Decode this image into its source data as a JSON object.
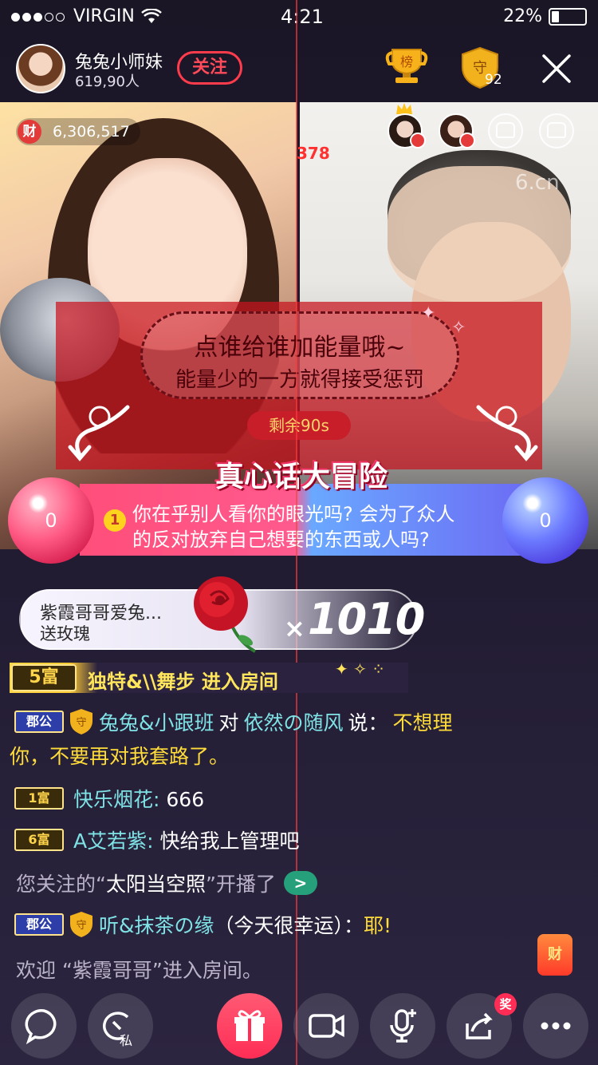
{
  "status_bar": {
    "carrier": "VIRGIN",
    "time": "4:21",
    "battery": "22%"
  },
  "header": {
    "host_name": "兔兔小师妹",
    "host_count": "619,90人",
    "follow_label": "关注",
    "rank_label": "榜",
    "guard_label": "守",
    "guard_count": "92"
  },
  "video": {
    "wealth_icon": "财",
    "wealth_value": "6,306,517",
    "coord_readout": "378",
    "watermark": "6.cn"
  },
  "task": {
    "line1": "点谁给谁加能量哦~",
    "line2": "能量少的一方就得接受惩罚",
    "countdown": "剩余90s",
    "title": "真心话大冒险",
    "question_number": "1",
    "question_line1": "你在乎别人看你的眼光吗? 会为了众人",
    "question_line2": "的反对放弃自己想要的东西或人吗?",
    "left_score": "0",
    "right_score": "0"
  },
  "gift": {
    "sender": "紫霞哥哥爱兔...",
    "action": "送玫瑰",
    "times": "×",
    "count": "1010"
  },
  "entrance": {
    "level": "5富",
    "text": "独特&\\\\舞步 进入房间"
  },
  "chat": {
    "m1": {
      "badge": "郡公",
      "guard": "守",
      "sender": "兔兔&小跟班",
      "mid": "对",
      "target": "依然の随风",
      "say": "说：",
      "text_a": "不想理",
      "text_b": "你，不要再对我套路了。"
    },
    "m2": {
      "badge": "1富",
      "sender": "快乐烟花",
      "colon": ":",
      "text": "666"
    },
    "m3": {
      "badge": "6富",
      "sender": "A艾若紫",
      "colon": ":",
      "text": "快给我上管理吧"
    },
    "m4": {
      "prefix": "您关注的“",
      "name": "太阳当空照",
      "suffix": "”开播了",
      "go": ">"
    },
    "m5": {
      "badge": "郡公",
      "guard": "守",
      "sender": "听&抹茶の缘",
      "note": "（今天很幸运）：",
      "text": "耶!"
    },
    "m6": {
      "text": "欢迎 “紫霞哥哥”进入房间。"
    }
  },
  "red_packet": "财",
  "bottom_bar": {
    "private_label": "私",
    "award_badge": "奖"
  },
  "colors": {
    "follow_red": "#ff3b4c",
    "name_cyan": "#7fe3e6",
    "name_yellow": "#ffdc3a",
    "gift_pink": "#ff2d55"
  }
}
